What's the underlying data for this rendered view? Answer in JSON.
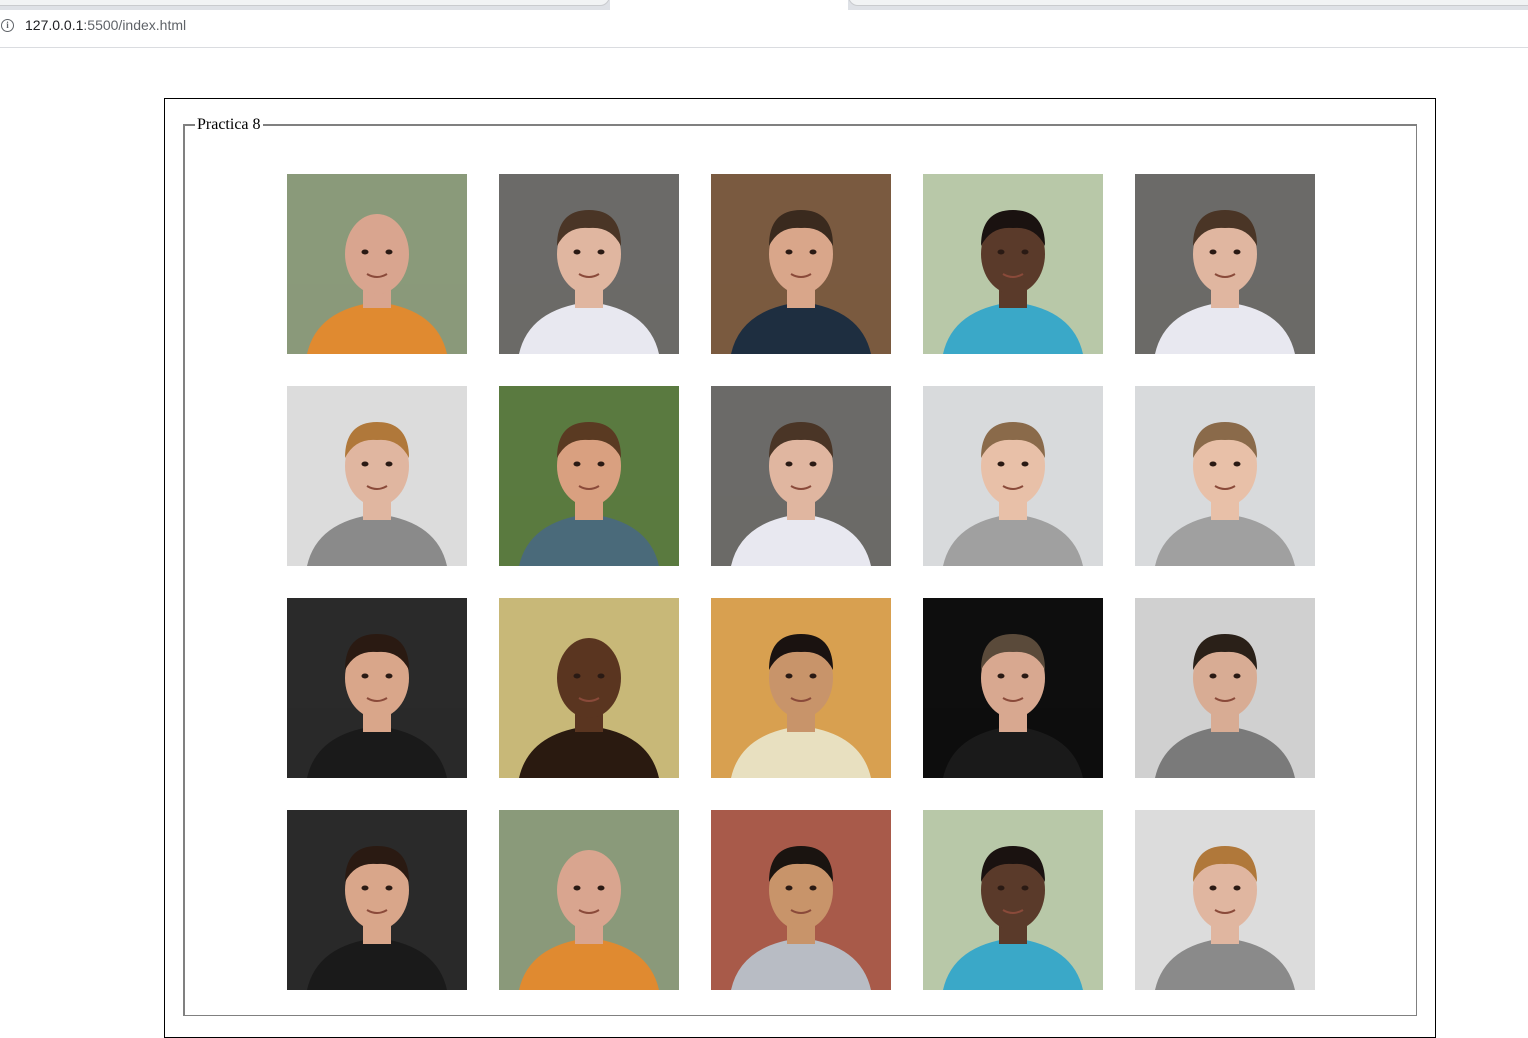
{
  "browser": {
    "url_host": "127.0.0.1",
    "url_rest": ":5500/index.html"
  },
  "page": {
    "legend": "Practica 8"
  },
  "photos": [
    {
      "bg": "#8a9a7a",
      "skin": "#d9a58f",
      "hair": "#c7977f",
      "shirt": "#e08a30",
      "bald": true
    },
    {
      "bg": "#6b6a68",
      "skin": "#e0b6a0",
      "hair": "#4a3526",
      "shirt": "#e8e8f0",
      "bald": false
    },
    {
      "bg": "#7a5a40",
      "skin": "#d9a68a",
      "hair": "#3a2a1e",
      "shirt": "#1e2e40",
      "bald": false
    },
    {
      "bg": "#b8c8a8",
      "skin": "#5a3a2a",
      "hair": "#1a1210",
      "shirt": "#3aa8c8",
      "bald": false
    },
    {
      "bg": "#6b6a68",
      "skin": "#e0b6a0",
      "hair": "#4a3526",
      "shirt": "#e8e8f0",
      "bald": false
    },
    {
      "bg": "#dcdcdc",
      "skin": "#e0b6a0",
      "hair": "#b0783a",
      "shirt": "#8a8a8a",
      "bald": false
    },
    {
      "bg": "#5a7a40",
      "skin": "#d9a080",
      "hair": "#5a3a22",
      "shirt": "#4a6a7a",
      "bald": false
    },
    {
      "bg": "#6b6a68",
      "skin": "#e0b6a0",
      "hair": "#4a3526",
      "shirt": "#e8e8f0",
      "bald": false
    },
    {
      "bg": "#d8dadc",
      "skin": "#e8c0a8",
      "hair": "#8a6a4a",
      "shirt": "#a0a0a0",
      "bald": false
    },
    {
      "bg": "#d8dadc",
      "skin": "#e8c0a8",
      "hair": "#8a6a4a",
      "shirt": "#a0a0a0",
      "bald": false
    },
    {
      "bg": "#2a2a2a",
      "skin": "#d9a68a",
      "hair": "#2a1a12",
      "shirt": "#1a1a1a",
      "bald": false
    },
    {
      "bg": "#c8b878",
      "skin": "#5a3520",
      "hair": "#3a2216",
      "shirt": "#2a1a10",
      "bald": true
    },
    {
      "bg": "#d8a050",
      "skin": "#c8946a",
      "hair": "#1a1210",
      "shirt": "#e8e0c0",
      "bald": false
    },
    {
      "bg": "#0e0e0e",
      "skin": "#d8a890",
      "hair": "#5a4a3a",
      "shirt": "#1a1a1a",
      "bald": false
    },
    {
      "bg": "#d0d0d0",
      "skin": "#d8ac94",
      "hair": "#2a2018",
      "shirt": "#7a7a7a",
      "bald": false
    },
    {
      "bg": "#2a2a2a",
      "skin": "#d9a68a",
      "hair": "#2a1a12",
      "shirt": "#1a1a1a",
      "bald": false
    },
    {
      "bg": "#8a9a7a",
      "skin": "#d9a58f",
      "hair": "#c7977f",
      "shirt": "#e08a30",
      "bald": true
    },
    {
      "bg": "#a85a4a",
      "skin": "#c8946a",
      "hair": "#1a1410",
      "shirt": "#b8bcc4",
      "bald": false
    },
    {
      "bg": "#b8c8a8",
      "skin": "#5a3a2a",
      "hair": "#1a1210",
      "shirt": "#3aa8c8",
      "bald": false
    },
    {
      "bg": "#dcdcdc",
      "skin": "#e0b6a0",
      "hair": "#b0783a",
      "shirt": "#8a8a8a",
      "bald": false
    }
  ]
}
